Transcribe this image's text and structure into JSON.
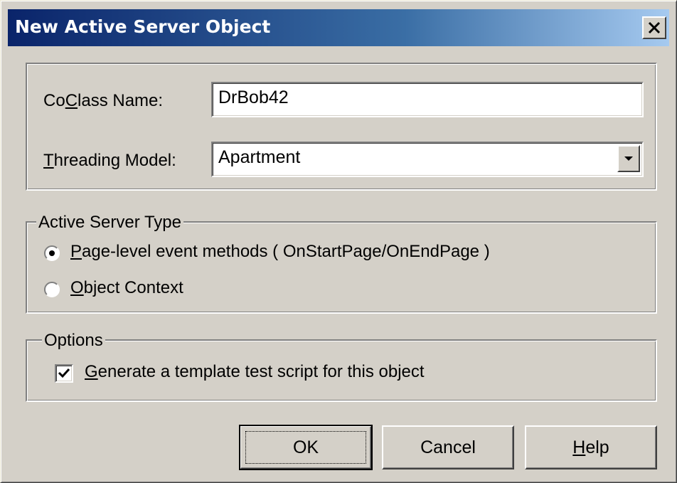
{
  "window": {
    "title": "New Active Server Object"
  },
  "fields": {
    "coclass_label_pre": "Co",
    "coclass_label_ul": "C",
    "coclass_label_post": "lass Name:",
    "coclass_value": "DrBob42",
    "threading_label_ul": "T",
    "threading_label_post": "hreading Model:",
    "threading_value": "Apartment"
  },
  "active_server_type": {
    "legend": "Active Server Type",
    "options": [
      {
        "label_ul": "P",
        "label_post": "age-level event methods ( OnStartPage/OnEndPage )",
        "selected": true
      },
      {
        "label_ul": "O",
        "label_post": "bject Context",
        "selected": false
      }
    ]
  },
  "options_group": {
    "legend": "Options",
    "checkbox_label_ul": "G",
    "checkbox_label_post": "enerate a template test script for this object",
    "checked": true
  },
  "buttons": {
    "ok": "OK",
    "cancel": "Cancel",
    "help_ul": "H",
    "help_post": "elp"
  },
  "icons": {
    "close": "close-icon",
    "dropdown": "chevron-down-icon",
    "check": "checkmark-icon"
  }
}
